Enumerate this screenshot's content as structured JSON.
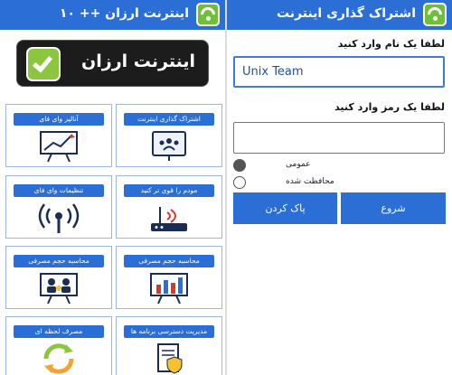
{
  "left_screen": {
    "title": "اینترنت ارزان ++ ۱۰",
    "banner": {
      "text": "اینترنت ارزان"
    },
    "tiles": [
      {
        "label": "اشتراک گذاری اینترنت",
        "icon": "shared-network-icon"
      },
      {
        "label": "آنالیز وای فای",
        "icon": "chart-analysis-icon"
      },
      {
        "label": "مودم را قوی تر کنید",
        "icon": "router-icon"
      },
      {
        "label": "تنظیمات وای فای",
        "icon": "wifi-tower-icon"
      },
      {
        "label": "محاسبه حجم مصرفی",
        "icon": "bar-chart-icon"
      },
      {
        "label": "محاسبه حجم مصرفی",
        "icon": "people-money-icon"
      },
      {
        "label": "مدیریت دسترسی برنامه ها",
        "icon": "document-shield-icon"
      },
      {
        "label": "مصرف لحظه ای",
        "icon": "refresh-arrows-icon"
      }
    ]
  },
  "right_screen": {
    "title": "اشتراک گذاری اینترنت",
    "name_label": "لطفا یک نام وارد کنید",
    "name_value": "Unix Team",
    "password_label": "لطفا یک رمز وارد کنید",
    "password_value": "",
    "radio_public": "عمومی",
    "radio_protected": "محافظت شده",
    "start_button": "شروع",
    "clear_button": "پاک کردن"
  },
  "colors": {
    "accent": "#2b6fd6",
    "banner_bg": "#1c1c1c",
    "check_green": "#8cc63f"
  }
}
